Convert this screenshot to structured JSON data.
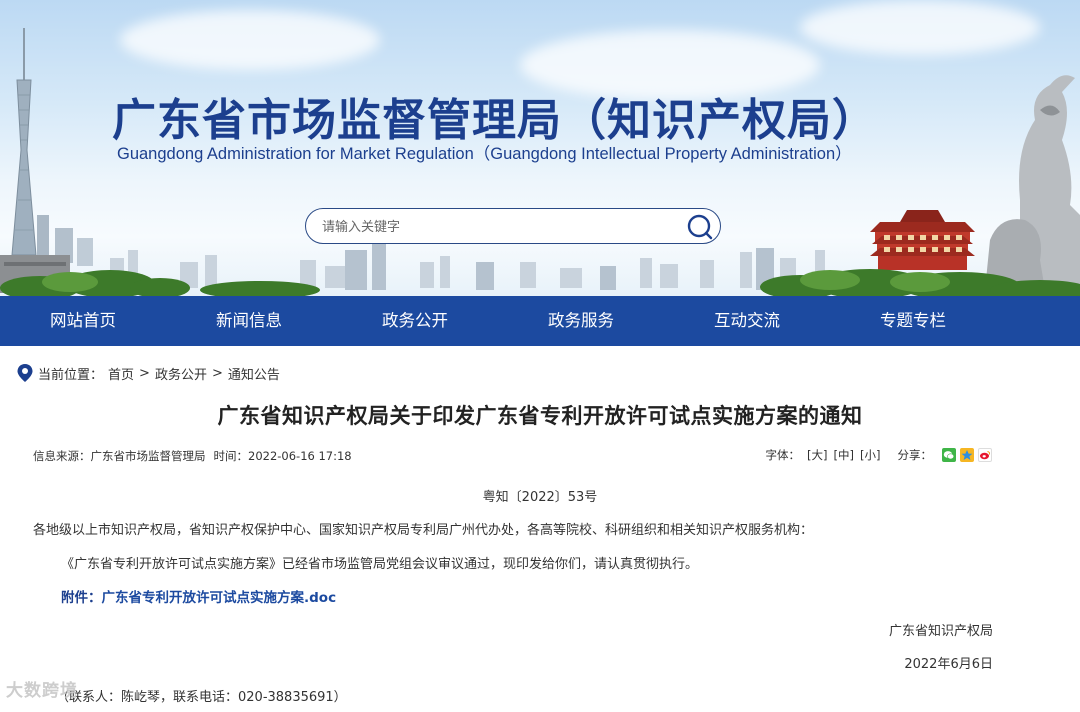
{
  "banner": {
    "title": "广东省市场监督管理局（知识产权局）",
    "subtitle": "Guangdong Administration for Market Regulation（Guangdong Intellectual Property Administration）",
    "search_placeholder": "请输入关键字"
  },
  "nav": {
    "items": [
      {
        "label": "网站首页"
      },
      {
        "label": "新闻信息"
      },
      {
        "label": "政务公开"
      },
      {
        "label": "政务服务"
      },
      {
        "label": "互动交流"
      },
      {
        "label": "专题专栏"
      }
    ]
  },
  "breadcrumb": {
    "prefix": "当前位置：",
    "items": [
      "首页",
      "政务公开",
      "通知公告"
    ],
    "separator": ">"
  },
  "article": {
    "title": "广东省知识产权局关于印发广东省专利开放许可试点实施方案的通知",
    "source_label": "信息来源：广东省市场监督管理局",
    "time_label": "时间：2022-06-16 17:18",
    "font_label": "字体：",
    "font_large": "[大]",
    "font_medium": "[中]",
    "font_small": "[小]",
    "share_label": "分享：",
    "doc_number": "粤知〔2022〕53号",
    "recipients": "各地级以上市知识产权局，省知识产权保护中心、国家知识产权局专利局广州代办处，各高等院校、科研组织和相关知识产权服务机构：",
    "body": "《广东省专利开放许可试点实施方案》已经省市场监管局党组会议审议通过，现印发给你们，请认真贯彻执行。",
    "attachment_label": "附件：",
    "attachment_file": "广东省专利开放许可试点实施方案.doc",
    "signature": "广东省知识产权局",
    "date": "2022年6月6日",
    "contact": "（联系人：陈屹琴，联系电话：020-38835691）"
  },
  "watermark": "大数跨境",
  "colors": {
    "nav_bg": "#1c4aa0",
    "title_blue": "#1c3f8e",
    "link_blue": "#1c4aa0"
  },
  "share_icons": [
    "wechat-icon",
    "qzone-icon",
    "weibo-icon"
  ]
}
